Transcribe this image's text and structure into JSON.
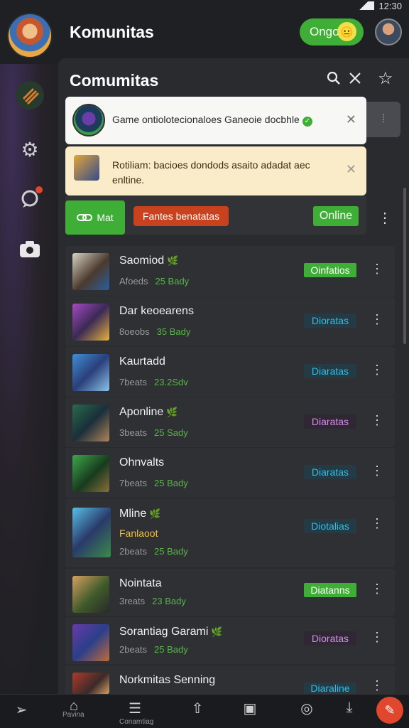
{
  "status_bar": {
    "time": "12:30"
  },
  "header": {
    "app_title": "Komunitas",
    "status_pill": "Ongo",
    "status_emoji": "😐"
  },
  "panel": {
    "title": "Comumitas"
  },
  "notifications": [
    {
      "text": "Game ontiolotecionaloes Ganeoie docbhle",
      "close": "✕"
    },
    {
      "text": "Rotiliam: bacioes dondods asaito adadat aec enltine.",
      "close": "✕"
    }
  ],
  "filter_bar": {
    "chip_green": "Mat",
    "chip_red": "Fantes benatatas",
    "chip_online": "Online"
  },
  "communities": [
    {
      "name": "Saomiod",
      "sub": "",
      "meta1": "Afoeds",
      "meta2": "25 Bady",
      "badge": "Oinfatios",
      "badge_style": "green"
    },
    {
      "name": "Dar keoearens",
      "sub": "",
      "meta1": "8oeobs",
      "meta2": "35 Bady",
      "badge": "Dioratas",
      "badge_style": "teal"
    },
    {
      "name": "Kaurtadd",
      "sub": "",
      "meta1": "7beats",
      "meta2": "23.2Sdv",
      "badge": "Diaratas",
      "badge_style": "teal"
    },
    {
      "name": "Aponline",
      "sub": "",
      "meta1": "3beats",
      "meta2": "25 Sady",
      "badge": "Diaratas",
      "badge_style": "violet"
    },
    {
      "name": "Ohnvalts",
      "sub": "",
      "meta1": "7beats",
      "meta2": "25 Bady",
      "badge": "Diaratas",
      "badge_style": "teal"
    },
    {
      "name": "Mline",
      "sub": "Fanlaoot",
      "meta1": "2beats",
      "meta2": "25 Bady",
      "badge": "Diotalias",
      "badge_style": "teal"
    },
    {
      "name": "Nointata",
      "sub": "",
      "meta1": "3reats",
      "meta2": "23 Bady",
      "badge": "Diatanns",
      "badge_style": "green"
    },
    {
      "name": "Sorantiag Garami",
      "sub": "",
      "meta1": "2beats",
      "meta2": "25 Bady",
      "badge": "Dioratas",
      "badge_style": "violet"
    },
    {
      "name": "Norkmitas Senning",
      "sub": "",
      "meta1": "",
      "meta2": "",
      "badge": "Diaraline",
      "badge_style": "teal"
    }
  ],
  "bottom_nav": {
    "label_left": "Pavina",
    "label_mid": "Conamtiag"
  },
  "colors": {
    "accent_green": "#3fae36",
    "accent_red": "#c8421e",
    "teal": "#2ec0e8"
  }
}
